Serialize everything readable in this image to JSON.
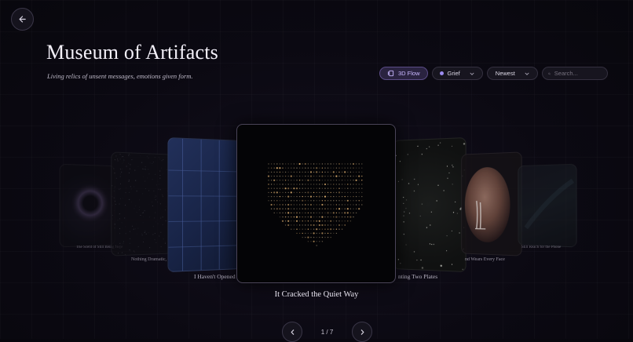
{
  "header": {
    "title": "Museum of Artifacts",
    "subtitle": "Living relics of unsent messages, emotions given form."
  },
  "controls": {
    "view_mode": "3D Flow",
    "filter": "Grief",
    "sort": "Newest",
    "search_placeholder": "Search..."
  },
  "carousel": {
    "active_title": "It Cracked the Quiet Way",
    "cards": [
      {
        "title": "The Scent of Still Being Here"
      },
      {
        "title": "Nothing Dramatic, Just"
      },
      {
        "title": "I Haven't Opened th"
      },
      {
        "title": "It Cracked the Quiet Way"
      },
      {
        "title": "nting Two Plates"
      },
      {
        "title": "nd Wears Every Face"
      },
      {
        "title": "Still Reach for the Phone"
      }
    ]
  },
  "pagination": {
    "current": "1",
    "total": "7",
    "text": "1 / 7"
  },
  "colors": {
    "accent": "#9c8cf0",
    "background": "#0b0912"
  }
}
